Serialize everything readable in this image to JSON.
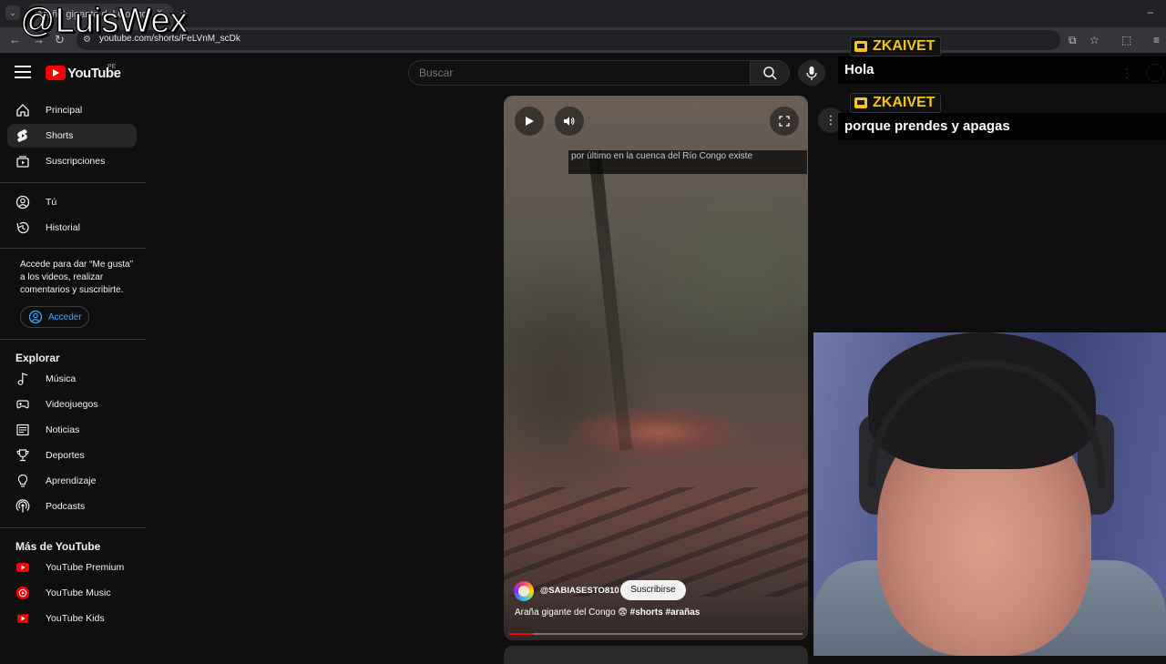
{
  "browser": {
    "tab_title": "Araña gigante del Congo",
    "tab_close": "×",
    "tab_new": "+",
    "url": "youtube.com/shorts/FeLVnM_scDk"
  },
  "watermark": "@LuisWex",
  "header": {
    "logo_text": "YouTube",
    "country_code": "PE",
    "search_placeholder": "Buscar",
    "kebab": "⋮"
  },
  "sidebar": {
    "main": [
      {
        "label": "Principal",
        "icon": "home-icon"
      },
      {
        "label": "Shorts",
        "icon": "shorts-icon",
        "active": true
      },
      {
        "label": "Suscripciones",
        "icon": "subscriptions-icon"
      }
    ],
    "you": [
      {
        "label": "Tú",
        "icon": "user-icon"
      },
      {
        "label": "Historial",
        "icon": "history-icon"
      }
    ],
    "signin_prompt": "Accede para dar “Me gusta” a los videos, realizar comentarios y suscribirte.",
    "signin_button": "Acceder",
    "explore_heading": "Explorar",
    "explore": [
      {
        "label": "Música",
        "icon": "music-icon"
      },
      {
        "label": "Videojuegos",
        "icon": "gamepad-icon"
      },
      {
        "label": "Noticias",
        "icon": "news-icon"
      },
      {
        "label": "Deportes",
        "icon": "trophy-icon"
      },
      {
        "label": "Aprendizaje",
        "icon": "lightbulb-icon"
      },
      {
        "label": "Podcasts",
        "icon": "podcast-icon"
      }
    ],
    "more_heading": "Más de YouTube",
    "more": [
      {
        "label": "YouTube Premium",
        "icon": "youtube-premium-icon"
      },
      {
        "label": "YouTube Music",
        "icon": "youtube-music-icon"
      },
      {
        "label": "YouTube Kids",
        "icon": "youtube-kids-icon"
      }
    ]
  },
  "short": {
    "caption": "por último en la cuenca del Río Congo existe",
    "channel": "@SABIASESTO810",
    "subscribe_label": "Suscribirse",
    "title_prefix": "Araña gigante del Congo",
    "title_emoji": "😨",
    "title_tags": "#shorts #arañas",
    "progress": 0.08,
    "more_label": "⋮"
  },
  "chat": [
    {
      "user": "ZKAIVET",
      "message": "Hola"
    },
    {
      "user": "ZKAIVET",
      "message": "porque prendes y apagas"
    }
  ],
  "colors": {
    "accent": "#3ea6ff",
    "brand": "#ff0000",
    "chat_name": "#f5c518"
  }
}
